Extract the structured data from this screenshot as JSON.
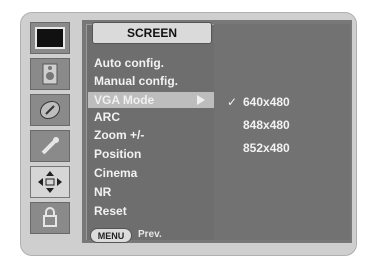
{
  "title": "SCREEN",
  "menu": {
    "items": [
      {
        "label": "Auto config."
      },
      {
        "label": "Manual config."
      },
      {
        "label": "VGA Mode"
      },
      {
        "label": "ARC"
      },
      {
        "label": "Zoom +/-"
      },
      {
        "label": "Position"
      },
      {
        "label": "Cinema"
      },
      {
        "label": "NR"
      },
      {
        "label": "Reset"
      }
    ],
    "selected_index": 2
  },
  "submenu": {
    "options": [
      {
        "label": "640x480",
        "checked": true
      },
      {
        "label": "848x480",
        "checked": false
      },
      {
        "label": "852x480",
        "checked": false
      }
    ],
    "check_mark": "✓"
  },
  "footer": {
    "menu_button": "MENU",
    "prev_label": "Prev."
  },
  "icons": [
    {
      "name": "picture-icon"
    },
    {
      "name": "sound-icon"
    },
    {
      "name": "time-icon"
    },
    {
      "name": "option-icon"
    },
    {
      "name": "screen-icon",
      "selected": true
    },
    {
      "name": "lock-icon"
    }
  ]
}
